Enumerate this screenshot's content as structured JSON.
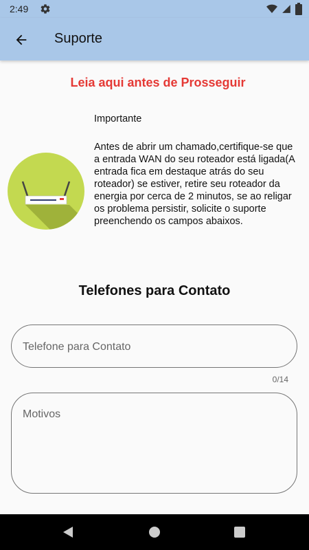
{
  "status_bar": {
    "time": "2:49"
  },
  "app_bar": {
    "title": "Suporte"
  },
  "content": {
    "warning": "Leia aqui antes de Prosseguir",
    "important_label": "Importante",
    "body": "Antes de abrir um chamado,certifique-se que a entrada WAN do seu roteador está ligada(A entrada fica em destaque atrás do seu roteador) se estiver, retire seu roteador da energia por cerca de 2 minutos, se ao religar os problema persistir, solicite o suporte preenchendo os campos abaixos.",
    "section_title": "Telefones para Contato"
  },
  "form": {
    "phone_placeholder": "Telefone para Contato",
    "phone_value": "",
    "phone_counter": "0/14",
    "reason_placeholder": "Motivos",
    "reason_value": ""
  },
  "icons": {
    "back": "arrow-left-icon",
    "router": "router-icon",
    "settings": "gear-icon",
    "wifi": "wifi-icon",
    "cell": "cell-signal-icon",
    "battery": "battery-icon"
  },
  "colors": {
    "app_bar": "#a9c7e8",
    "warning": "#e53935",
    "router_circle": "#c3d950"
  }
}
